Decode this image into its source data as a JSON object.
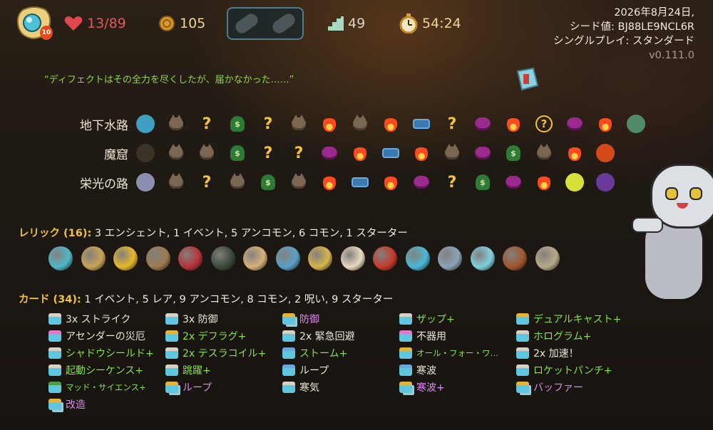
{
  "topbar": {
    "hp": "13/89",
    "gold": "105",
    "floor": "49",
    "time": "54:24",
    "ascension_badge": "10",
    "icons": {
      "character": "character-portrait-icon",
      "hp": "heart-icon",
      "gold": "gold-coin-icon",
      "floor": "stairs-icon",
      "time": "stopwatch-icon"
    }
  },
  "run_info": {
    "date": "2026年8月24日,",
    "seed": "シード値: BJ88LE9NCL6R",
    "mode": "シングルプレイ: スタンダード",
    "version": "v0.111.0"
  },
  "quote": "“ディフェクトはその全力を尽くしたが、届かなかった……”",
  "acts": [
    {
      "label": "地下水路",
      "nodes": [
        "boss-blue",
        "monster",
        "unknown",
        "treasure",
        "unknown",
        "monster",
        "rest",
        "monster",
        "rest",
        "shop",
        "unknown",
        "elite",
        "rest",
        "unknown-gold",
        "elite",
        "rest",
        "boss-green"
      ]
    },
    {
      "label": "魔窟",
      "nodes": [
        "boss-dark",
        "monster",
        "monster",
        "treasure",
        "unknown",
        "unknown",
        "elite",
        "rest",
        "shop",
        "rest",
        "monster",
        "elite",
        "treasure",
        "monster",
        "rest",
        "boss-orange"
      ]
    },
    {
      "label": "栄光の路",
      "nodes": [
        "boss-grey",
        "monster",
        "unknown",
        "monster",
        "treasure",
        "monster",
        "rest",
        "shop",
        "rest",
        "elite",
        "unknown",
        "treasure",
        "elite",
        "rest",
        "boss-yellow",
        "boss-purple"
      ]
    }
  ],
  "relics": {
    "label": "レリック (16):",
    "summary": " 3 エンシェント, 1 イベント, 5 アンコモン, 6 コモン, 1 スターター",
    "items": [
      "crystal-orb-icon",
      "ancient-tablet-icon",
      "banana-icon",
      "backpack-icon",
      "red-cushion-icon",
      "lantern-icon",
      "cracked-core-icon",
      "anvil-icon",
      "bow-icon",
      "candy-orbs-icon",
      "nunchaku-icon",
      "battery-icon",
      "crumpled-shield-icon",
      "prism-icon",
      "mushroom-icon",
      "snail-shell-icon"
    ]
  },
  "cards": {
    "label": "カード (34):",
    "summary": " 1 イベント, 5 レア, 9 アンコモン, 8 コモン, 2 呪い, 9 スターター",
    "columns": [
      [
        {
          "text": "3x ストライク",
          "color": "white",
          "icon": "card-common-icon"
        },
        {
          "text": "アセンダーの災厄",
          "color": "white",
          "icon": "card-curse-icon"
        },
        {
          "text": "シャドウシールド+",
          "color": "green",
          "icon": "card-common-icon"
        },
        {
          "text": "起動シーケンス+",
          "color": "green",
          "icon": "card-common-icon"
        },
        {
          "text": "マッド・サイエンス+",
          "color": "green",
          "icon": "card-event-icon",
          "small": true
        },
        {
          "text": "改造",
          "color": "purple",
          "icon": "card-enchanted-icon"
        }
      ],
      [
        {
          "text": "3x 防御",
          "color": "white",
          "icon": "card-common-icon"
        },
        {
          "text": "2x デフラグ+",
          "color": "green",
          "icon": "card-rare-icon"
        },
        {
          "text": "2x テスラコイル+",
          "color": "green",
          "icon": "card-common-icon"
        },
        {
          "text": "跳躍+",
          "color": "green",
          "icon": "card-common-icon"
        },
        {
          "text": "ループ",
          "color": "purple",
          "icon": "card-enchanted-icon"
        }
      ],
      [
        {
          "text": "防御",
          "color": "purple",
          "icon": "card-enchanted-icon"
        },
        {
          "text": "2x 緊急回避",
          "color": "white",
          "icon": "card-common-icon"
        },
        {
          "text": "ストーム+",
          "color": "green",
          "icon": "card-uncommon-icon"
        },
        {
          "text": "ループ",
          "color": "white",
          "icon": "card-uncommon-icon"
        },
        {
          "text": "寒気",
          "color": "white",
          "icon": "card-common-icon"
        }
      ],
      [
        {
          "text": "ザップ+",
          "color": "green",
          "icon": "card-common-icon"
        },
        {
          "text": "不器用",
          "color": "white",
          "icon": "card-curse-icon"
        },
        {
          "text": "オール・フォー・ワ…",
          "color": "green",
          "icon": "card-rare-icon",
          "small": true
        },
        {
          "text": "寒波",
          "color": "white",
          "icon": "card-uncommon-icon"
        },
        {
          "text": "寒波+",
          "color": "purple",
          "icon": "card-enchanted-icon"
        }
      ],
      [
        {
          "text": "デュアルキャスト+",
          "color": "green",
          "icon": "card-starter-icon"
        },
        {
          "text": "ホログラム+",
          "color": "green",
          "icon": "card-common-icon"
        },
        {
          "text": "2x 加速！",
          "color": "white",
          "icon": "card-common-icon"
        },
        {
          "text": "ロケットパンチ+",
          "color": "green",
          "icon": "card-common-icon"
        },
        {
          "text": "バッファー",
          "color": "purple",
          "icon": "card-enchanted-icon"
        }
      ]
    ]
  },
  "colors": {
    "text": "#ece6d6",
    "hp_red": "#e0595c",
    "gold": "#efd593",
    "green_text": "#86e14a",
    "purple_text": "#e08af0",
    "section_gold": "#f2c33a",
    "quote_green": "#93d44a"
  },
  "mascot": "grey-cat-mascot-icon"
}
